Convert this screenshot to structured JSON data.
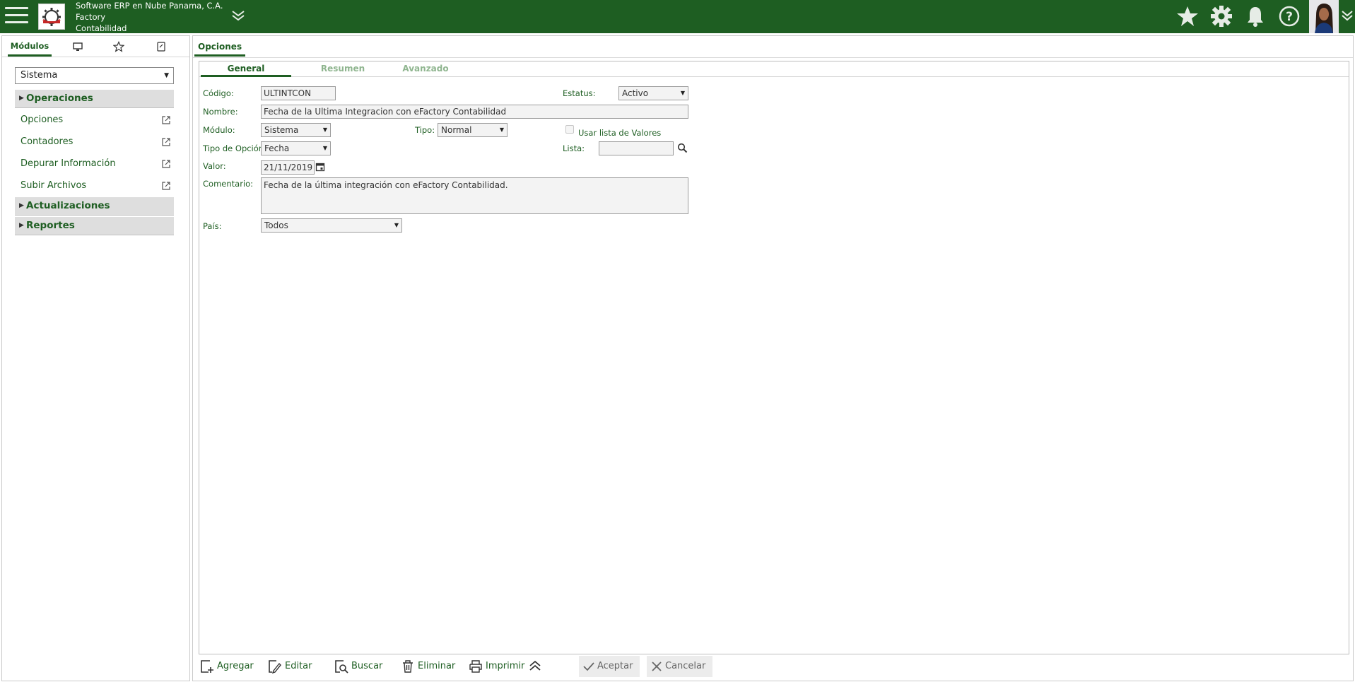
{
  "header": {
    "company": "Software ERP en Nube Panama, C.A.",
    "product": "Factory",
    "module": "Contabilidad"
  },
  "left": {
    "tabs": {
      "modules_label": "Módulos"
    },
    "module_select": "Sistema",
    "sections": {
      "operations": "Operaciones",
      "updates": "Actualizaciones",
      "reports": "Reportes"
    },
    "items": [
      {
        "label": "Opciones"
      },
      {
        "label": "Contadores"
      },
      {
        "label": "Depurar Información"
      },
      {
        "label": "Subir Archivos"
      }
    ]
  },
  "main": {
    "tab_title": "Opciones",
    "subtabs": [
      "General",
      "Resumen",
      "Avanzado"
    ],
    "form": {
      "codigo_label": "Código:",
      "codigo_value": "ULTINTCON",
      "estatus_label": "Estatus:",
      "estatus_value": "Activo",
      "nombre_label": "Nombre:",
      "nombre_value": "Fecha de la Ultima Integracion con eFactory Contabilidad",
      "modulo_label": "Módulo:",
      "modulo_value": "Sistema",
      "tipo_label": "Tipo:",
      "tipo_value": "Normal",
      "usar_lista_label": "Usar lista de Valores",
      "tipo_opcion_label": "Tipo de Opción:",
      "tipo_opcion_value": "Fecha",
      "lista_label": "Lista:",
      "lista_value": "",
      "valor_label": "Valor:",
      "valor_value": "21/11/2019",
      "comentario_label": "Comentario:",
      "comentario_value": "Fecha de la última integración con eFactory Contabilidad.",
      "pais_label": "País:",
      "pais_value": "Todos"
    }
  },
  "toolbar": {
    "add": "Agregar",
    "edit": "Editar",
    "search": "Buscar",
    "delete": "Eliminar",
    "print": "Imprimir",
    "accept": "Aceptar",
    "cancel": "Cancelar"
  },
  "colors": {
    "brand": "#1e5e22",
    "inactive_tab": "#8fb58f"
  }
}
